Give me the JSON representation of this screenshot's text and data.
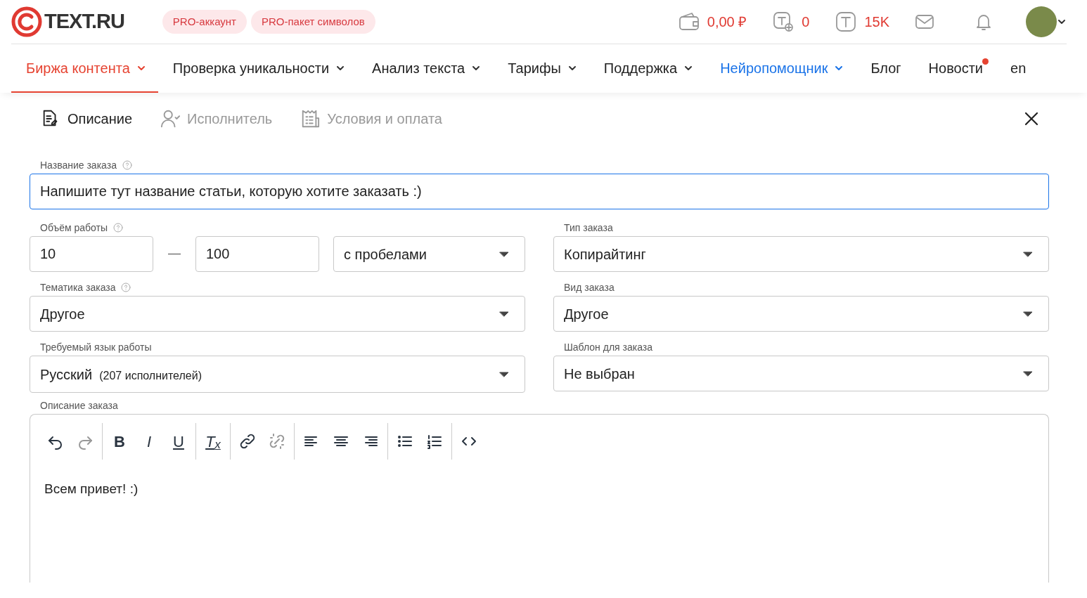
{
  "header": {
    "logo_text": "TEXT.RU",
    "pro_buttons": [
      "PRO-аккаунт",
      "PRO-пакет символов"
    ],
    "stats": [
      {
        "kind": "wallet",
        "value": "0,00 ₽"
      },
      {
        "kind": "token-plus",
        "value": "0"
      },
      {
        "kind": "token",
        "value": "15K"
      }
    ]
  },
  "nav": [
    {
      "label": "Биржа контента",
      "selected": true,
      "dropdown": true,
      "kind": "plain",
      "badge": false
    },
    {
      "label": "Проверка уникальности",
      "selected": false,
      "dropdown": true,
      "kind": "plain",
      "badge": false
    },
    {
      "label": "Анализ текста",
      "selected": false,
      "dropdown": true,
      "kind": "plain",
      "badge": false
    },
    {
      "label": "Тарифы",
      "selected": false,
      "dropdown": true,
      "kind": "plain",
      "badge": false
    },
    {
      "label": "Поддержка",
      "selected": false,
      "dropdown": true,
      "kind": "plain",
      "badge": false
    },
    {
      "label": "Нейропомощник",
      "selected": false,
      "dropdown": true,
      "kind": "accent",
      "badge": false
    },
    {
      "label": "Блог",
      "selected": false,
      "dropdown": false,
      "kind": "plain",
      "badge": false
    },
    {
      "label": "Новости",
      "selected": false,
      "dropdown": false,
      "kind": "plain",
      "badge": true
    },
    {
      "label": "en",
      "selected": false,
      "dropdown": false,
      "kind": "plain",
      "badge": false
    }
  ],
  "steps": [
    {
      "kind": "description",
      "label": "Описание",
      "selected": true
    },
    {
      "kind": "performer",
      "label": "Исполнитель",
      "selected": false
    },
    {
      "kind": "payment",
      "label": "Условия и оплата",
      "selected": false
    }
  ],
  "form": {
    "title": {
      "label": "Название заказа",
      "help": true,
      "value": "Напишите тут название статьи, которую хотите заказать :)"
    },
    "volume": {
      "label": "Объём работы",
      "help": true,
      "from": "10",
      "to": "100",
      "mode": "с пробелами"
    },
    "type": {
      "label": "Тип заказа",
      "value": "Копирайтинг"
    },
    "topic": {
      "label": "Тематика заказа",
      "help": true,
      "value": "Другое"
    },
    "kind": {
      "label": "Вид заказа",
      "value": "Другое"
    },
    "language": {
      "label": "Требуемый язык работы",
      "value": "Русский",
      "note": "(207 исполнителей)"
    },
    "template": {
      "label": "Шаблон для заказа",
      "value": "Не выбран"
    },
    "description": {
      "label": "Описание заказа",
      "text": "Всем привет! :)",
      "toolbar": [
        [
          {
            "kind": "undo",
            "disabled": false
          },
          {
            "kind": "redo",
            "disabled": true
          }
        ],
        [
          {
            "kind": "bold",
            "label": "B",
            "disabled": false
          },
          {
            "kind": "italic",
            "label": "I",
            "disabled": false
          },
          {
            "kind": "underline",
            "label": "U",
            "disabled": false
          }
        ],
        [
          {
            "kind": "clear-format",
            "label": "T$_{x}$",
            "disabled": false
          }
        ],
        [
          {
            "kind": "link",
            "disabled": false
          },
          {
            "kind": "unlink",
            "disabled": true
          }
        ],
        [
          {
            "kind": "align-left",
            "disabled": false
          },
          {
            "kind": "align-center",
            "disabled": false
          },
          {
            "kind": "align-right",
            "disabled": false
          }
        ],
        [
          {
            "kind": "bullet-list",
            "disabled": false
          },
          {
            "kind": "numbered-list",
            "disabled": false
          }
        ],
        [
          {
            "kind": "code",
            "disabled": false
          }
        ]
      ]
    }
  }
}
